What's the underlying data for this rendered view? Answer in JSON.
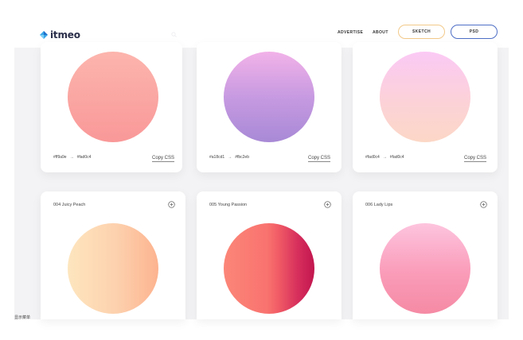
{
  "header": {
    "logo_text": "itmeo",
    "nav": [
      "ADVERTISE",
      "ABOUT"
    ],
    "buttons": {
      "sketch": "SKETCH",
      "psd": "PSD"
    }
  },
  "row1": [
    {
      "from": "#ff9a9e",
      "to": "#fad0c4",
      "copy": "Copy CSS"
    },
    {
      "from": "#a18cd1",
      "to": "#fbc2eb",
      "copy": "Copy CSS"
    },
    {
      "from": "#fad0c4",
      "to": "#fad0c4",
      "copy": "Copy CSS"
    }
  ],
  "row2": [
    {
      "title": "004 Juicy Peach"
    },
    {
      "title": "005 Young Passion"
    },
    {
      "title": "006 Lady Lips"
    }
  ],
  "arrow": "→",
  "footer_note": "显示菜单",
  "colors": {
    "sketch_border": "#f2c98a",
    "psd_border": "#4f6fc6",
    "content_background": "#f3f3f5"
  }
}
